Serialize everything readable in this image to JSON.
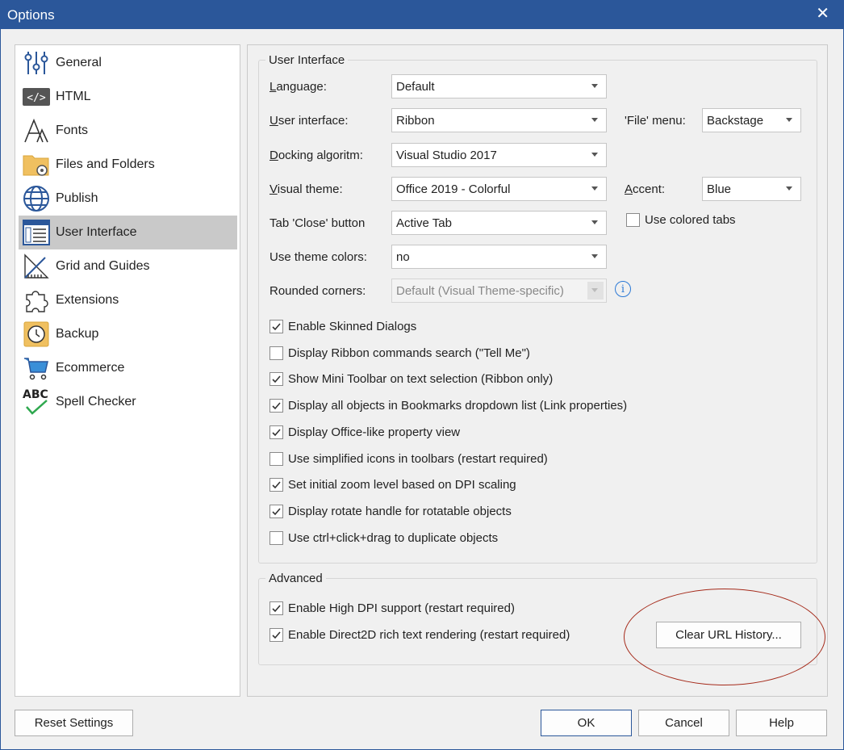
{
  "window": {
    "title": "Options",
    "close_glyph": "✕"
  },
  "sidebar": {
    "items": [
      {
        "label": "General",
        "icon": "sliders-icon"
      },
      {
        "label": "HTML",
        "icon": "code-icon"
      },
      {
        "label": "Fonts",
        "icon": "font-icon"
      },
      {
        "label": "Files and Folders",
        "icon": "folder-gear-icon"
      },
      {
        "label": "Publish",
        "icon": "globe-icon"
      },
      {
        "label": "User Interface",
        "icon": "window-list-icon",
        "selected": true
      },
      {
        "label": "Grid and Guides",
        "icon": "ruler-icon"
      },
      {
        "label": "Extensions",
        "icon": "puzzle-icon"
      },
      {
        "label": "Backup",
        "icon": "history-icon"
      },
      {
        "label": "Ecommerce",
        "icon": "cart-icon"
      },
      {
        "label": "Spell Checker",
        "icon": "abc-check-icon"
      }
    ]
  },
  "ui_group": {
    "title": "User Interface",
    "language": {
      "label_u": "L",
      "label_rest": "anguage:",
      "value": "Default"
    },
    "user_interface": {
      "label_u": "U",
      "label_rest": "ser interface:",
      "value": "Ribbon"
    },
    "file_menu": {
      "label": "'File' menu:",
      "value": "Backstage"
    },
    "docking": {
      "label_u": "D",
      "label_rest": "ocking algoritm:",
      "value": "Visual Studio 2017"
    },
    "visual_theme": {
      "label_u": "V",
      "label_rest": "isual theme:",
      "value": "Office 2019 - Colorful"
    },
    "accent": {
      "label_u": "A",
      "label_rest": "ccent:",
      "value": "Blue"
    },
    "tab_close": {
      "label": "Tab 'Close' button",
      "value": "Active Tab"
    },
    "colored_tabs": {
      "label": "Use colored tabs",
      "checked": false
    },
    "theme_colors": {
      "label": "Use theme colors:",
      "value": "no"
    },
    "rounded_corners": {
      "label": "Rounded corners:",
      "value": "Default (Visual Theme-specific)",
      "info_glyph": "i"
    },
    "checkboxes": [
      {
        "label": "Enable Skinned Dialogs",
        "checked": true
      },
      {
        "label": "Display Ribbon commands search (\"Tell Me\")",
        "checked": false
      },
      {
        "label": "Show Mini Toolbar on text selection (Ribbon only)",
        "checked": true
      },
      {
        "label": "Display all objects in Bookmarks dropdown list (Link properties)",
        "checked": true
      },
      {
        "label": "Display Office-like property view",
        "checked": true
      },
      {
        "label": "Use simplified icons in toolbars (restart required)",
        "checked": false
      },
      {
        "label": "Set initial zoom level based on DPI scaling",
        "checked": true
      },
      {
        "label": "Display rotate handle for rotatable objects",
        "checked": true
      },
      {
        "label": "Use ctrl+click+drag to duplicate objects",
        "checked": false
      }
    ]
  },
  "advanced_group": {
    "title": "Advanced",
    "checkboxes": [
      {
        "label": "Enable High DPI support (restart required)",
        "checked": true
      },
      {
        "label": "Enable Direct2D rich text rendering (restart required)",
        "checked": true
      }
    ],
    "clear_url_history": "Clear URL History..."
  },
  "footer": {
    "reset": "Reset Settings",
    "ok": "OK",
    "cancel": "Cancel",
    "help": "Help"
  },
  "colors": {
    "titlebar": "#2b579a",
    "highlight": "#a52a1a",
    "info": "#2b79d6",
    "check": "#333333"
  }
}
